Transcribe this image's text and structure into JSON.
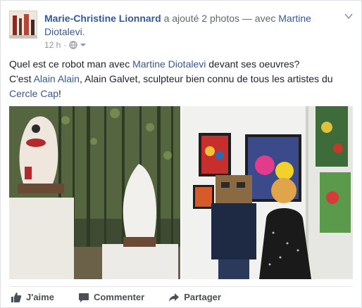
{
  "post": {
    "author": "Marie-Christine Lionnard",
    "action_text": " a ajouté 2 photos — avec ",
    "tagged_person": "Martine Diotalevi",
    "tagged_suffix": ".",
    "timestamp": "12 h",
    "visibility_icon": "globe-icon",
    "menu_icon": "chevron-down-icon"
  },
  "body": {
    "line1_pre": "Quel est ce robot man avec ",
    "line1_link": "Martine Diotalevi",
    "line1_post": " devant ses oeuvres?",
    "line2_pre": "C'est ",
    "line2_link": "Alain Alain",
    "line2_post": ", Alain Galvet, sculpteur bien connu de tous les artistes du",
    "line3_link": "Cercle Cap",
    "line3_post": "!"
  },
  "photos": [
    {
      "subject": "sculptures-in-bamboo-garden"
    },
    {
      "subject": "people-in-gallery-with-paintings"
    }
  ],
  "actions": {
    "like": "J'aime",
    "comment": "Commenter",
    "share": "Partager"
  },
  "colors": {
    "link": "#365899",
    "meta": "#90949c",
    "action": "#4b4f56"
  }
}
